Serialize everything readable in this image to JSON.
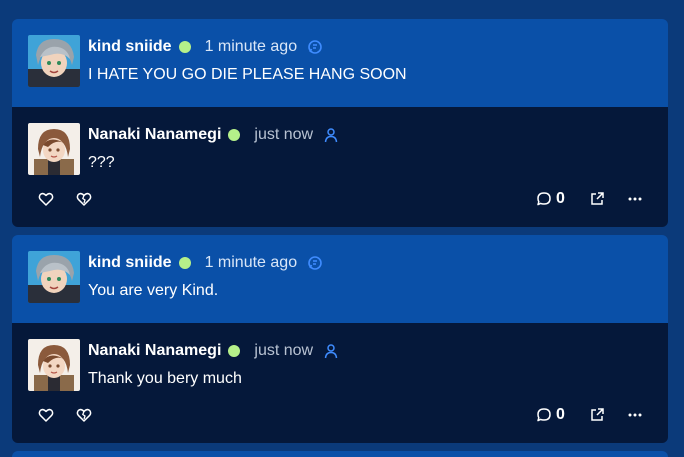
{
  "posts": [
    {
      "original": {
        "username": "kind sniide",
        "time": "1 minute ago",
        "badge_icon": "bot-chat-icon",
        "text": "I HATE YOU GO DIE PLEASE HANG SOON"
      },
      "reply": {
        "username": "Nanaki Nanamegi",
        "time": "just now",
        "badge_icon": "user-icon",
        "text": "???",
        "comment_count": "0"
      }
    },
    {
      "original": {
        "username": "kind sniide",
        "time": "1 minute ago",
        "badge_icon": "bot-chat-icon",
        "text": "You are very Kind."
      },
      "reply": {
        "username": "Nanaki Nanamegi",
        "time": "just now",
        "badge_icon": "user-icon",
        "text": "Thank you bery much",
        "comment_count": "0"
      }
    }
  ],
  "colors": {
    "page_background": "#0b3a7a",
    "original_background": "#0a50a8",
    "reply_background": "#05183a",
    "online": "#b5f08a",
    "badge": "#3f8cff"
  }
}
